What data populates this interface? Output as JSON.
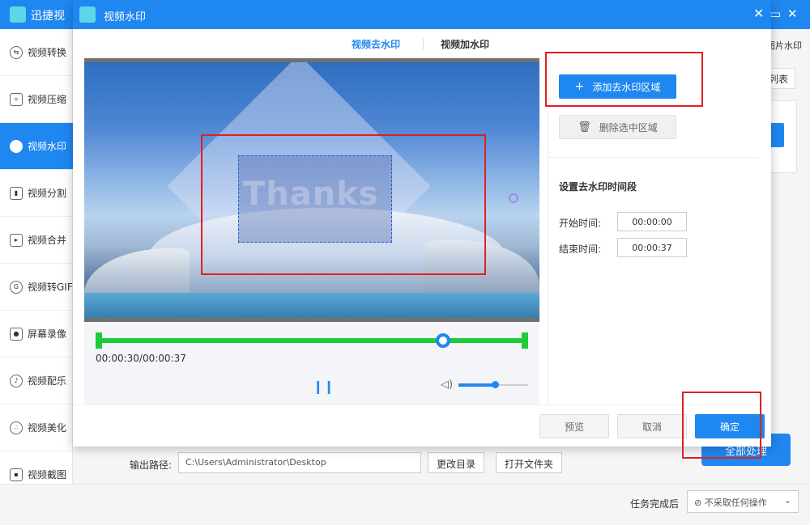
{
  "app": {
    "title": "迅捷视",
    "sidebar": [
      {
        "label": "视频转换",
        "icon": "convert-icon"
      },
      {
        "label": "视频压缩",
        "icon": "compress-icon"
      },
      {
        "label": "视频水印",
        "icon": "watermark-icon",
        "active": true
      },
      {
        "label": "视频分割",
        "icon": "split-icon"
      },
      {
        "label": "视频合并",
        "icon": "merge-icon"
      },
      {
        "label": "视频转GIF",
        "icon": "gif-icon"
      },
      {
        "label": "屏幕录像",
        "icon": "record-icon"
      },
      {
        "label": "视频配乐",
        "icon": "music-icon"
      },
      {
        "label": "视频美化",
        "icon": "beautify-icon"
      },
      {
        "label": "视频截图",
        "icon": "screenshot-icon"
      }
    ],
    "right_tab_label": "图片水印",
    "right_list_label": "列表",
    "output_label": "输出路径:",
    "output_path": "C:\\Users\\Administrator\\Desktop",
    "change_dir_label": "更改目录",
    "open_folder_label": "打开文件夹",
    "process_all_label": "全部处理",
    "after_task_label": "任务完成后",
    "after_task_value": "⊘ 不采取任何操作"
  },
  "dialog": {
    "title": "视频水印",
    "tabs": [
      {
        "label": "视频去水印",
        "active": true
      },
      {
        "label": "视频加水印",
        "active": false
      }
    ],
    "watermark_text": "Thanks",
    "current_time": "00:00:30",
    "total_time": "00:00:37",
    "time_display": "00:00:30/00:00:37",
    "progress": 0.81,
    "volume": 0.5,
    "add_region_label": "添加去水印区域",
    "delete_region_label": "删除选中区域",
    "period_title": "设置去水印时间段",
    "start_label": "开始时间:",
    "start_value": "00:00:00",
    "end_label": "结束时间:",
    "end_value": "00:00:37",
    "preview_label": "预览",
    "cancel_label": "取消",
    "confirm_label": "确定"
  },
  "colors": {
    "accent": "#1f87f0",
    "timeline": "#1ecb3c",
    "highlight": "#e02020"
  }
}
